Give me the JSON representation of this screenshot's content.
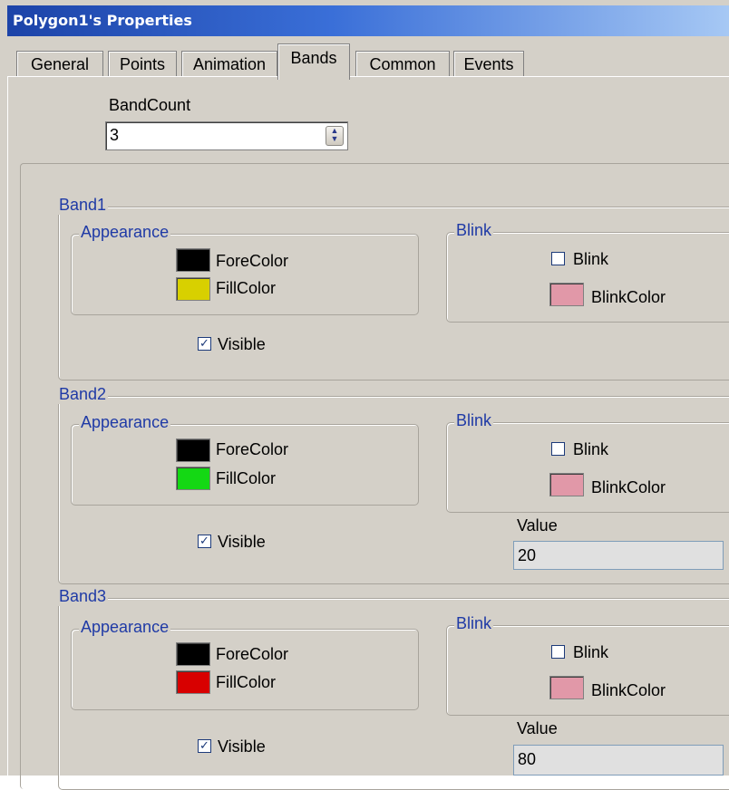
{
  "window": {
    "title": "Polygon1's Properties"
  },
  "tabs": [
    {
      "label": "General"
    },
    {
      "label": "Points"
    },
    {
      "label": "Animation"
    },
    {
      "label": "Bands"
    },
    {
      "label": "Common"
    },
    {
      "label": "Events"
    }
  ],
  "active_tab": "Bands",
  "band_count": {
    "label": "BandCount",
    "value": "3"
  },
  "bands": [
    {
      "title": "Band1",
      "appearance": "Appearance",
      "fore_color_label": "ForeColor",
      "fore_color": "#000000",
      "fill_color_label": "FillColor",
      "fill_color": "#d8d000",
      "visible_label": "Visible",
      "visible_checked": true,
      "blink_group": "Blink",
      "blink_label": "Blink",
      "blink_checked": false,
      "blink_color_label": "BlinkColor",
      "blink_color": "#e198a8"
    },
    {
      "title": "Band2",
      "appearance": "Appearance",
      "fore_color_label": "ForeColor",
      "fore_color": "#000000",
      "fill_color_label": "FillColor",
      "fill_color": "#14d814",
      "visible_label": "Visible",
      "visible_checked": true,
      "blink_group": "Blink",
      "blink_label": "Blink",
      "blink_checked": false,
      "blink_color_label": "BlinkColor",
      "blink_color": "#e198a8",
      "value_label": "Value",
      "value": "20"
    },
    {
      "title": "Band3",
      "appearance": "Appearance",
      "fore_color_label": "ForeColor",
      "fore_color": "#000000",
      "fill_color_label": "FillColor",
      "fill_color": "#d80000",
      "visible_label": "Visible",
      "visible_checked": true,
      "blink_group": "Blink",
      "blink_label": "Blink",
      "blink_checked": false,
      "blink_color_label": "BlinkColor",
      "blink_color": "#e198a8",
      "value_label": "Value",
      "value": "80"
    }
  ],
  "icons": {
    "spin": "spin-updown-icon",
    "check": "checkmark-icon"
  }
}
